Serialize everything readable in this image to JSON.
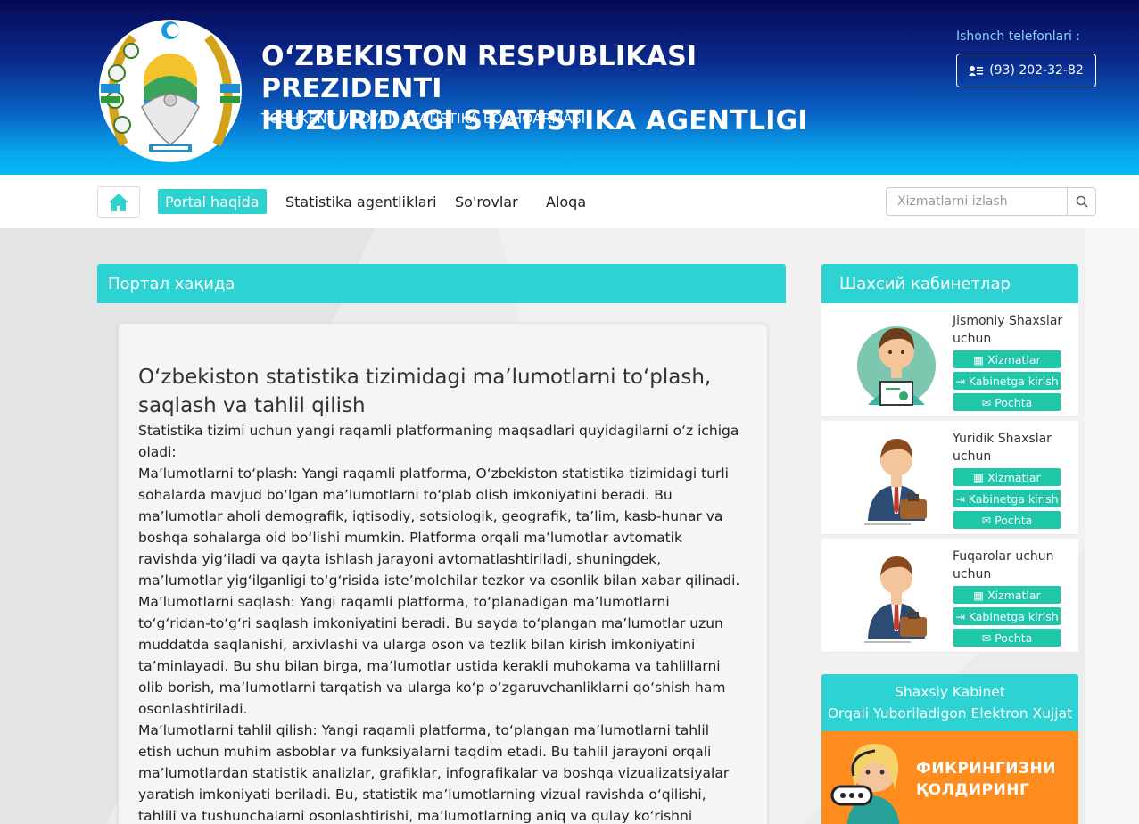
{
  "header": {
    "title_line1": "O‘ZBEKISTON RESPUBLIKASI PREZIDENTI",
    "title_line2": "HUZURIDAGI STATISTIKA AGENTLIGI",
    "subtitle": "TOSHKENT VILOYATI STATISTIKA BOSHQARMASI",
    "hotline_label": "Ishonch telefonlari :",
    "hotline_number": "(93) 202-32-82"
  },
  "nav": {
    "items": [
      "Portal haqida",
      "Statistika agentliklari",
      "So'rovlar",
      "Aloqa"
    ],
    "active": "Portal haqida",
    "search_placeholder": "Xizmatlarni izlash"
  },
  "main": {
    "section_title": "Портал хақида",
    "article_title": "O‘zbekiston statistika tizimidagi ma’lumotlarni to‘plash, saqlash va tahlil qilish",
    "paragraphs": [
      "Statistika tizimi uchun yangi raqamli platformaning maqsadlari quyidagilarni o‘z ichiga oladi:",
      "Ma’lumotlarni to‘plash: Yangi raqamli platforma, O‘zbekiston statistika tizimidagi turli sohalarda mavjud bo‘lgan ma’lumotlarni to‘plab olish imkoniyatini beradi. Bu ma’lumotlar aholi demografik, iqtisodiy, sotsiologik, geografik, ta’lim, kasb-hunar va boshqa sohalarga oid bo‘lishi mumkin. Platforma orqali ma’lumotlar avtomatik ravishda yig‘iladi va qayta ishlash jarayoni avtomatlashtiriladi, shuningdek, ma’lumotlar yig‘ilganligi to‘g‘risida iste’molchilar tezkor va osonlik bilan xabar qilinadi.",
      "Ma’lumotlarni saqlash: Yangi raqamli platforma, to‘planadigan ma’lumotlarni to‘g‘ridan-to‘g‘ri saqlash imkoniyatini beradi. Bu sayda to‘plangan ma’lumotlar uzun muddatda saqlanishi, arxivlashi va ularga oson va tezlik bilan kirish imkoniyatini ta’minlayadi. Bu shu bilan birga, ma’lumotlar ustida kerakli muhokama va tahlillarni olib borish, ma’lumotlarni tarqatish va ularga ko‘p o‘zgaruvchanliklarni qo‘shish ham osonlashtiriladi.",
      "Ma’lumotlarni tahlil qilish: Yangi raqamli platforma, to‘plangan ma’lumotlarni tahlil etish uchun muhim asboblar va funksiyalarni taqdim etadi. Bu tahlil jarayoni orqali ma’lumotlardan statistik analizlar, grafiklar, infografikalar va boshqa vizualizatsiyalar yaratish imkoniyati beriladi. Bu, statistik ma’lumotlarning vizual ravishda o‘qilishi, tahlili va tushunchalarni osonlashtirishi, ma’lumotlarning aniq va qulay ko‘rishni ta’minlashi imkoniyatini beradi."
    ]
  },
  "sidebar": {
    "title": "Шахсий кабинетлар",
    "cabinets": [
      {
        "title": "Jismoniy Shaxslar uchun",
        "btn1": "Xizmatlar",
        "btn2": "Kabinetga kirish",
        "btn3": "Pochta"
      },
      {
        "title": "Yuridik Shaxslar uchun",
        "btn1": "Xizmatlar",
        "btn2": "Kabinetga kirish",
        "btn3": "Pochta"
      },
      {
        "title": "Fuqarolar uchun uchun",
        "btn1": "Xizmatlar",
        "btn2": "Kabinetga kirish",
        "btn3": "Pochta"
      }
    ],
    "doc_line1": "Shaxsiy Kabinet",
    "doc_line2": "Orqali Yuboriladigon Elektron Xujjat",
    "feedback_line1": "ФИКРИНГИЗНИ",
    "feedback_line2": "ҚОЛДИРИНГ"
  },
  "colors": {
    "accent": "#2dd2d3",
    "button_green": "#1dc7a8",
    "feedback_orange": "#ff8c1e",
    "header_dark": "#050a55",
    "header_light": "#06b9f5"
  }
}
